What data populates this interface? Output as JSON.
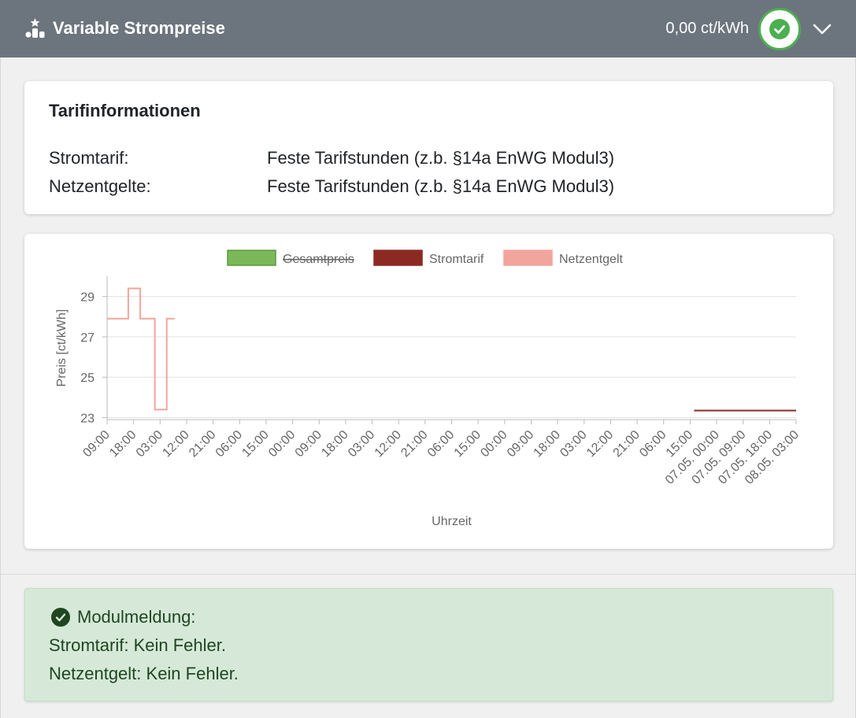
{
  "header": {
    "title": "Variable Strompreise",
    "price": "0,00 ct/kWh",
    "icon": "ranking-icon",
    "status_icon": "check-circle-icon",
    "expand_icon": "chevron-down-icon",
    "accent": "#4caf50"
  },
  "tarif": {
    "title": "Tarifinformationen",
    "rows": [
      {
        "label": "Stromtarif:",
        "value": "Feste Tarifstunden (z.b. §14a EnWG Modul3)"
      },
      {
        "label": "Netzentgelte:",
        "value": "Feste Tarifstunden (z.b. §14a EnWG Modul3)"
      }
    ]
  },
  "chart_data": {
    "type": "line",
    "step": true,
    "title": "",
    "xlabel": "Uhrzeit",
    "ylabel": "Preis [ct/kWh]",
    "ylim": [
      22.9,
      30.0
    ],
    "yticks": [
      23,
      25,
      27,
      29
    ],
    "grid": true,
    "legend_position": "top-center",
    "categories": [
      "09:00",
      "18:00",
      "03:00",
      "12:00",
      "21:00",
      "06:00",
      "15:00",
      "00:00",
      "09:00",
      "18:00",
      "03:00",
      "12:00",
      "21:00",
      "06:00",
      "15:00",
      "00:00",
      "09:00",
      "18:00",
      "03:00",
      "12:00",
      "21:00",
      "06:00",
      "15:00",
      "07.05. 00:00",
      "07.05. 09:00",
      "07.05. 18:00",
      "08.05. 03:00"
    ],
    "series": [
      {
        "name": "Gesamtpreis",
        "color": "#7cb85a",
        "hidden": true,
        "points": []
      },
      {
        "name": "Stromtarif",
        "color": "#8b2a22",
        "hidden": false,
        "points": [
          [
            22.15,
            23.35
          ],
          [
            26.0,
            23.35
          ]
        ]
      },
      {
        "name": "Netzentgelt",
        "color": "#f0a69c",
        "hidden": false,
        "points": [
          [
            0,
            27.9
          ],
          [
            0.8,
            27.9
          ],
          [
            0.8,
            29.4
          ],
          [
            1.25,
            29.4
          ],
          [
            1.25,
            27.9
          ],
          [
            1.8,
            27.9
          ],
          [
            1.8,
            23.4
          ],
          [
            2.25,
            23.4
          ],
          [
            2.25,
            27.9
          ],
          [
            2.55,
            27.9
          ]
        ]
      }
    ]
  },
  "alert": {
    "icon": "check-circle-icon",
    "title": "Modulmeldung:",
    "lines": [
      "Stromtarif: Kein Fehler.",
      "Netzentgelt: Kein Fehler."
    ],
    "color": "#d6e9d8"
  }
}
